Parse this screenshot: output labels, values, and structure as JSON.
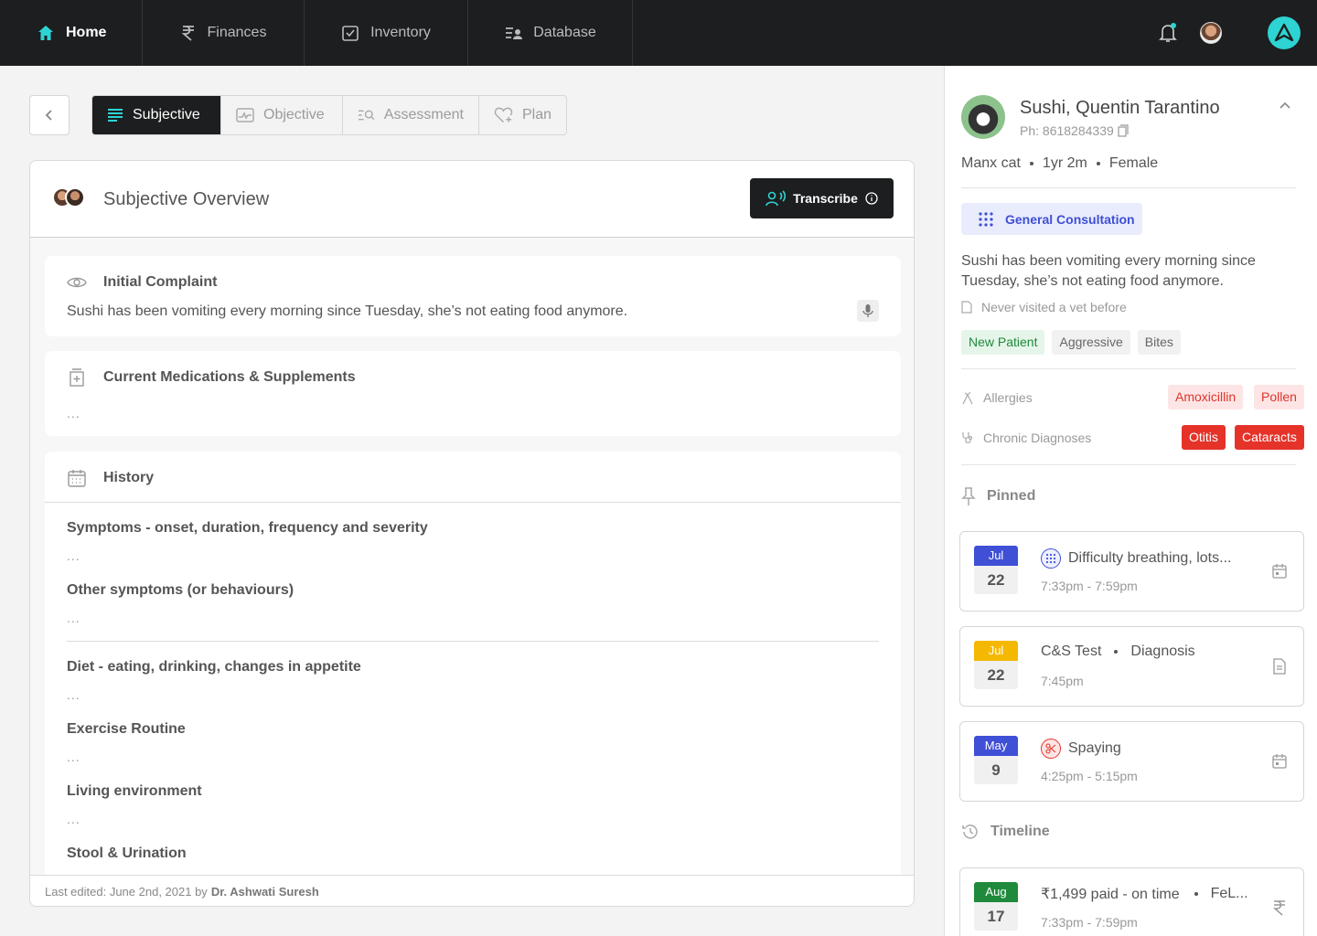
{
  "nav": {
    "home": "Home",
    "finances": "Finances",
    "inventory": "Inventory",
    "database": "Database"
  },
  "tabs": {
    "subjective": "Subjective",
    "objective": "Objective",
    "assessment": "Assessment",
    "plan": "Plan"
  },
  "overview": {
    "title": "Subjective Overview",
    "transcribe_label": "Transcribe"
  },
  "initial_complaint": {
    "title": "Initial Complaint",
    "text": "Sushi has been vomiting every morning since Tuesday, she’s not eating food anymore."
  },
  "medications": {
    "title": "Current Medications & Supplements",
    "placeholder": "..."
  },
  "history": {
    "title": "History",
    "items": [
      {
        "label": "Symptoms - onset, duration, frequency and severity",
        "value": "..."
      },
      {
        "label": "Other symptoms (or behaviours)",
        "value": "..."
      },
      {
        "label": "Diet - eating, drinking, changes in appetite",
        "value": "..."
      },
      {
        "label": "Exercise Routine",
        "value": "..."
      },
      {
        "label": "Living environment",
        "value": "..."
      },
      {
        "label": "Stool & Urination",
        "value": ""
      }
    ]
  },
  "footer": {
    "prefix": "Last edited: June 2nd, 2021 by",
    "author": "Dr. Ashwati Suresh"
  },
  "patient": {
    "name": "Sushi, Quentin Tarantino",
    "phone": "Ph: 8618284339",
    "breed": "Manx cat",
    "age": "1yr 2m",
    "sex": "Female",
    "consultation": "General Consultation",
    "description": "Sushi has been vomiting every morning since Tuesday, she’s not eating food anymore.",
    "note": "Never visited a vet before",
    "tags": [
      "New Patient",
      "Aggressive",
      "Bites"
    ],
    "allergies_label": "Allergies",
    "allergies": [
      "Amoxicillin",
      "Pollen"
    ],
    "chronic_label": "Chronic Diagnoses",
    "chronic": [
      "Otitis",
      "Cataracts"
    ]
  },
  "pinned": {
    "title": "Pinned",
    "events": [
      {
        "month": "Jul",
        "day": "22",
        "title": "Difficulty breathing, lots...",
        "time": "7:33pm - 7:59pm",
        "month_color": "#3f4fd6"
      },
      {
        "month": "Jul",
        "day": "22",
        "title": "C&S Test",
        "subtitle": "Diagnosis",
        "time": "7:45pm",
        "month_color": "#f5b800"
      },
      {
        "month": "May",
        "day": "9",
        "title": "Spaying",
        "time": "4:25pm - 5:15pm",
        "month_color": "#3f4fd6"
      }
    ]
  },
  "timeline": {
    "title": "Timeline",
    "events": [
      {
        "month": "Aug",
        "day": "17",
        "title": "₹1,499 paid - on time",
        "subtitle": "FeL...",
        "time": "7:33pm - 7:59pm",
        "month_color": "#1f8a3b"
      }
    ]
  }
}
